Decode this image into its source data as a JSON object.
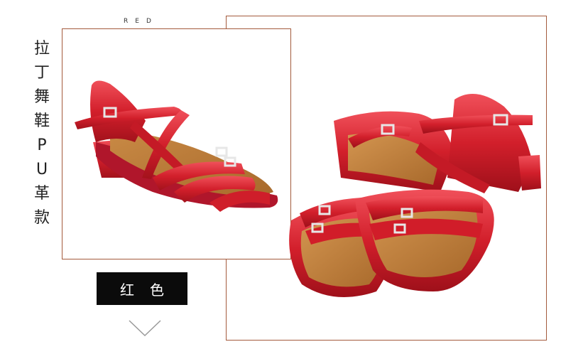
{
  "color_tag": "RED",
  "vertical_title": [
    "拉",
    "丁",
    "舞",
    "鞋",
    "P",
    "U",
    "革",
    "款"
  ],
  "color_label": "红色",
  "icons": {
    "down": "chevron-down-icon"
  },
  "colors": {
    "frame": "#a35a3c",
    "shoe": "#d21f2b",
    "insole": "#b87535",
    "label_bg": "#0b0b0b"
  }
}
